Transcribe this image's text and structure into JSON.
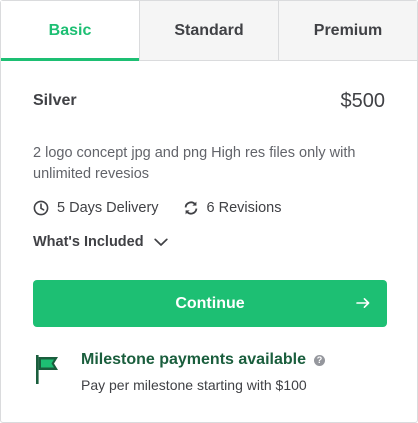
{
  "tabs": [
    {
      "label": "Basic",
      "active": true
    },
    {
      "label": "Standard",
      "active": false
    },
    {
      "label": "Premium",
      "active": false
    }
  ],
  "package": {
    "name": "Silver",
    "price": "$500",
    "description": "2 logo concept jpg and png High res files only with unlimited revesios",
    "delivery": "5 Days Delivery",
    "revisions": "6 Revisions",
    "included_label": "What's Included"
  },
  "continue_label": "Continue",
  "milestone": {
    "title": "Milestone payments available",
    "help_icon": "?",
    "subtitle": "Pay per milestone starting with $100"
  },
  "colors": {
    "accent": "#1dbf73",
    "milestone_title": "#1a5e3d",
    "text": "#404145"
  },
  "icons": {
    "delivery": "clock-icon",
    "revisions": "refresh-icon",
    "included": "chevron-down-icon",
    "continue": "arrow-right-icon",
    "milestone": "flag-icon",
    "help": "help-icon"
  }
}
